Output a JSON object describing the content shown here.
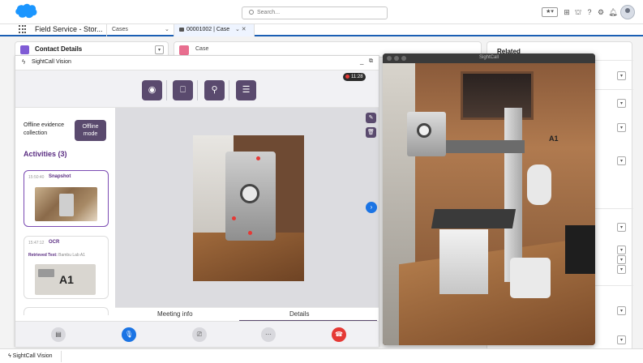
{
  "header": {
    "search_placeholder": "Search...",
    "fav_label": "★▾"
  },
  "nav": {
    "app_name": "Field Service - Stor...",
    "tabs": [
      {
        "label": "Cases"
      },
      {
        "label": "00001002 | Case"
      }
    ]
  },
  "workspace": {
    "contact_title": "Contact Details",
    "case_title": "Case",
    "related_title": "Related"
  },
  "vision": {
    "title": "SightCall Vision",
    "recording_time": "11:28",
    "offline_label": "Offline evidence collection",
    "offline_button": "Offline mode",
    "activities_title": "Activities (3)",
    "activities": [
      {
        "time": "15:50:40",
        "type": "Snapshot"
      },
      {
        "time": "15:47:12",
        "type": "OCR",
        "retrieved_label": "Retrieved Text:",
        "retrieved_text": "Bambu Lab A1",
        "thumb_text": "A1"
      }
    ],
    "tabs": {
      "meeting": "Meeting info",
      "details": "Details"
    }
  },
  "video": {
    "title": "SightCall",
    "printer_label": "A1"
  },
  "utility": {
    "item_label": "SightCall Vision"
  },
  "colors": {
    "brand_purple": "#5a4a6e",
    "accent_blue": "#1b74e4",
    "end_call_red": "#e53935",
    "salesforce_blue": "#1b96ff"
  }
}
